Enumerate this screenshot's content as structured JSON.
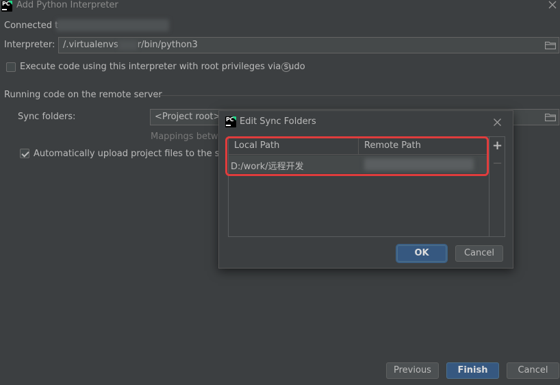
{
  "window": {
    "title": "Add Python Interpreter"
  },
  "form": {
    "connected_label": "Connected t",
    "interpreter_label": "Interpreter:",
    "interpreter_value_prefix": "/.virtualenvs",
    "interpreter_value_suffix": "r/bin/python3",
    "sudo_checkbox_label": "Execute code using this interpreter with root privileges via sudo",
    "sudo_checked": false,
    "section_title": "Running code on the remote server",
    "sync_folders_label": "Sync folders:",
    "sync_folders_value": "<Project root>→",
    "mappings_hint": "Mappings betwe",
    "auto_upload_label": "Automatically upload project files to the server",
    "auto_upload_checked": true
  },
  "dialog": {
    "title": "Edit Sync Folders",
    "columns": [
      "Local Path",
      "Remote Path"
    ],
    "rows": [
      {
        "local": "D:/work/远程开发",
        "remote": ""
      }
    ],
    "ok_label": "OK",
    "cancel_label": "Cancel",
    "add_symbol": "+",
    "remove_symbol": "−"
  },
  "footer": {
    "previous_label": "Previous",
    "finish_label": "Finish",
    "cancel_label": "Cancel"
  },
  "colors": {
    "background": "#3c3f41",
    "primary_button": "#365880",
    "highlight_border": "#e03c3c"
  }
}
